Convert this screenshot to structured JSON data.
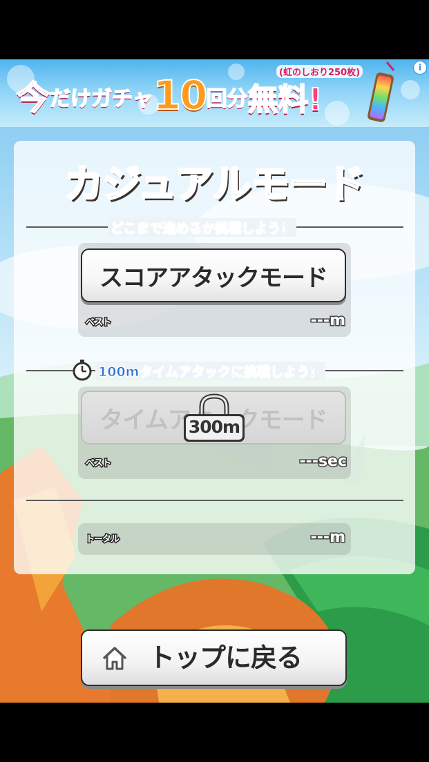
{
  "ad": {
    "headline_1": "今",
    "headline_2": "だけ",
    "headline_3": "ガチャ",
    "headline_4": "10",
    "headline_5": "回分",
    "headline_6": "無料!",
    "subtext": "(虹のしおり250枚)",
    "info_icon": "i"
  },
  "title": "カジュアルモード",
  "score_section": {
    "caption": "どこまで進めるか挑戦しよう！",
    "button_label": "スコアアタックモード",
    "best_label": "ベスト",
    "best_value": "---m"
  },
  "time_section": {
    "caption": "100mタイムアタックに挑戦しよう！",
    "button_label": "タイムアタックモード",
    "lock_label": "300m",
    "best_label": "ベスト",
    "best_value": "---sec"
  },
  "total_section": {
    "label": "トータル",
    "value": "---m"
  },
  "top_button": {
    "label": "トップに戻る"
  },
  "colors": {
    "caption_blue": "#2a6fd1",
    "ad_pink": "#ff3e7a",
    "ad_orange": "#ff9a1a",
    "title_dark": "#403a34"
  },
  "icons": {
    "stopwatch": "stopwatch-icon",
    "home": "home-icon",
    "lock": "lock-icon",
    "ad_info": "info-icon"
  }
}
